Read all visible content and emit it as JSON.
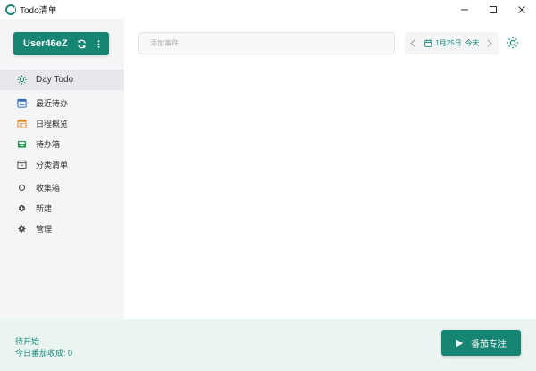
{
  "window": {
    "title": "Todo清单",
    "controls": [
      "minimize-icon",
      "maximize-icon",
      "close-icon"
    ]
  },
  "sidebar": {
    "user": {
      "name": "User46eZ",
      "icons": [
        "sync-icon",
        "more-vertical-icon"
      ]
    },
    "items": [
      {
        "label": "Day Todo",
        "icon": "sun-icon",
        "active": true
      },
      {
        "label": "最近待办",
        "icon": "calendar-list-icon"
      },
      {
        "label": "日程概览",
        "icon": "calendar-icon"
      },
      {
        "label": "待办箱",
        "icon": "inbox-icon"
      },
      {
        "label": "分类清单",
        "icon": "folder-list-icon"
      },
      {
        "label": "收集箱",
        "icon": "circle-icon"
      },
      {
        "label": "新建",
        "icon": "plus-circle-icon"
      },
      {
        "label": "管理",
        "icon": "gear-icon"
      }
    ]
  },
  "main": {
    "add_input": {
      "placeholder": "添加事件",
      "value": ""
    },
    "date_nav": {
      "date": "1月25日",
      "today_label": "今天"
    }
  },
  "bottom": {
    "status": "待开始",
    "harvest": "今日番茄收成: 0",
    "focus_button": "番茄专注"
  },
  "colors": {
    "accent": "#168574",
    "sidebar_bg": "#f4f5f7",
    "bottom_bg": "#eaf5f2",
    "active_item_bg": "#e6e8eb"
  }
}
